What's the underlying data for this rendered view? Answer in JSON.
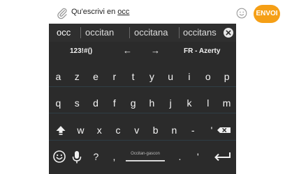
{
  "composer": {
    "prefix": "Qu'escrivi en ",
    "typed": "occ",
    "send_label": "ENVOI",
    "attach_icon": "paperclip-icon",
    "emoji_icon": "smiley-icon",
    "send_color": "#f59f16"
  },
  "keyboard": {
    "background": "#2b2b2b",
    "suggestions": [
      "occ",
      "occitan",
      "occitana",
      "occitans"
    ],
    "toolbar": {
      "symbols_label": "123!#()",
      "left_arrow": "←",
      "right_arrow": "→",
      "layout_label": "FR - Azerty"
    },
    "row1": [
      "a",
      "z",
      "e",
      "r",
      "t",
      "y",
      "u",
      "i",
      "o",
      "p"
    ],
    "row2": [
      "q",
      "s",
      "d",
      "f",
      "g",
      "h",
      "j",
      "k",
      "l",
      "m"
    ],
    "row3": [
      "w",
      "x",
      "c",
      "v",
      "b",
      "n",
      "-",
      "'"
    ],
    "bottom": {
      "question": "?",
      "comma": ",",
      "space_label": "Occitan-gascon",
      "period": ".",
      "apostrophe": "'"
    }
  }
}
